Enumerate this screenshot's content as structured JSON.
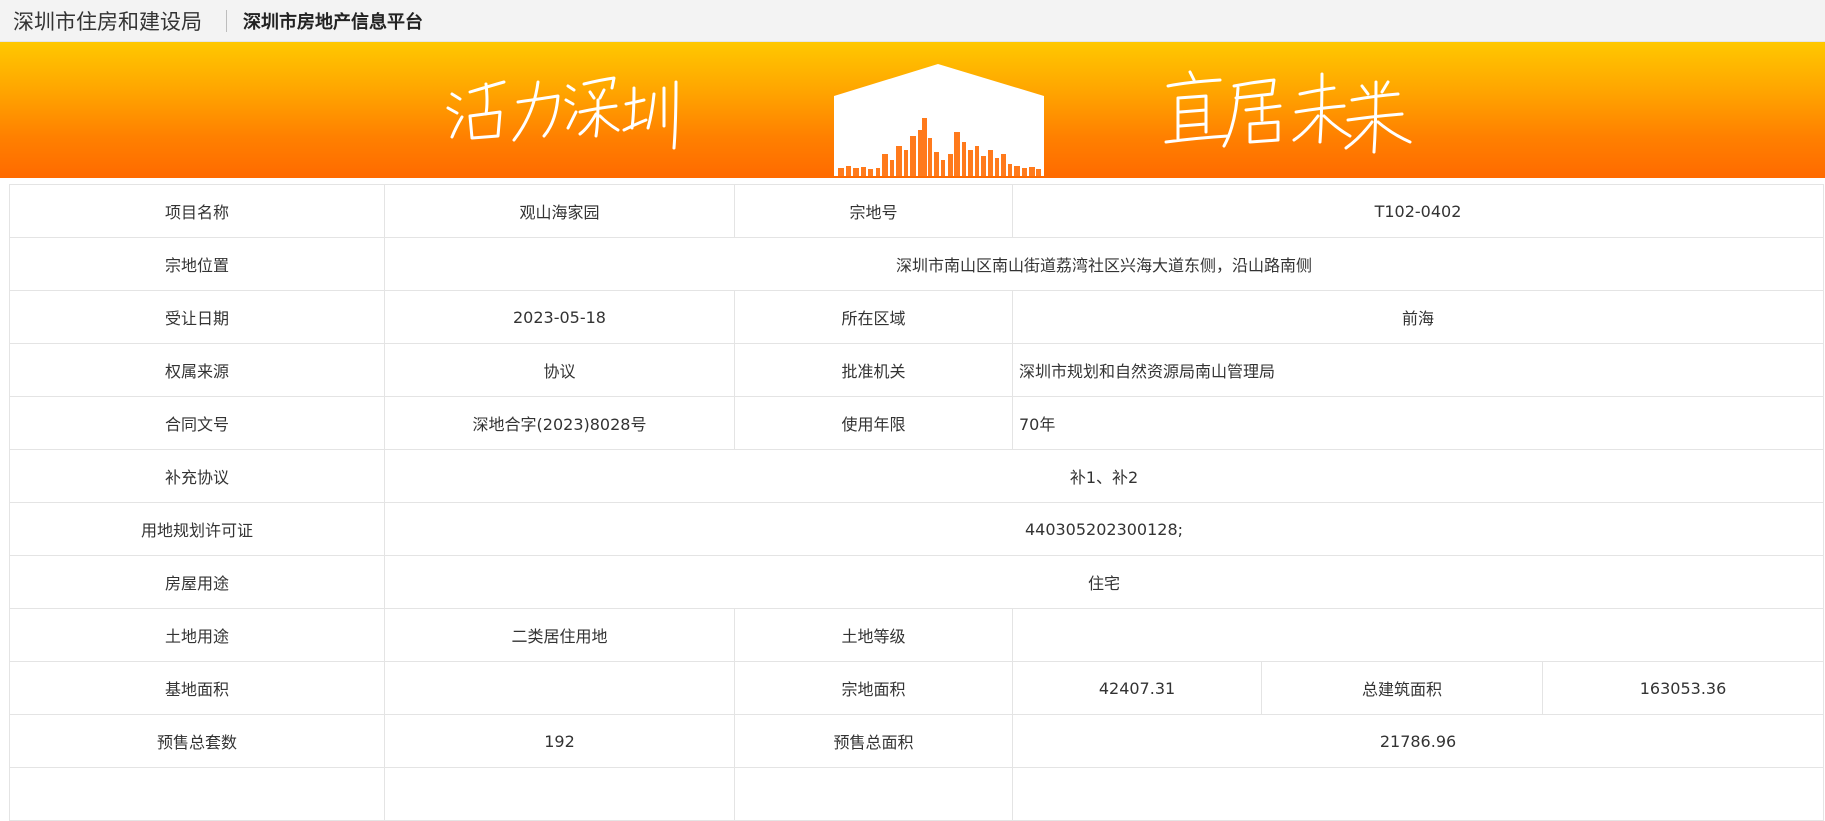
{
  "header": {
    "org_name": "深圳市住房和建设局",
    "platform_name": "深圳市房地产信息平台"
  },
  "banner": {
    "slogan_left": "活力深圳",
    "slogan_right": "宜居未来",
    "colors": {
      "top": "#ffc800",
      "bottom": "#ff6a00"
    }
  },
  "project": {
    "name_label": "项目名称",
    "name": "观山海家园",
    "lot_no_label": "宗地号",
    "lot_no": "T102-0402",
    "location_label": "宗地位置",
    "location": "深圳市南山区南山街道荔湾社区兴海大道东侧，沿山路南侧",
    "transfer_date_label": "受让日期",
    "transfer_date": "2023-05-18",
    "district_label": "所在区域",
    "district": "前海",
    "ownership_label": "权属来源",
    "ownership": "协议",
    "approval_label": "批准机关",
    "approval": "深圳市规划和自然资源局南山管理局",
    "contract_label": "合同文号",
    "contract": "深地合字(2023)8028号",
    "term_label": "使用年限",
    "term": "70年",
    "supplement_label": "补充协议",
    "supplement": "补1、补2",
    "permit_label": "用地规划许可证",
    "permit": "440305202300128;",
    "usage_label": "房屋用途",
    "usage": "住宅",
    "land_use_label": "土地用途",
    "land_use": "二类居住用地",
    "land_grade_label": "土地等级",
    "land_grade": "",
    "base_area_label": "基地面积",
    "base_area": "",
    "lot_area_label": "宗地面积",
    "lot_area": "42407.31",
    "total_floor_area_label": "总建筑面积",
    "total_floor_area": "163053.36",
    "presale_units_label": "预售总套数",
    "presale_units": "192",
    "presale_area_label": "预售总面积",
    "presale_area": "21786.96"
  }
}
